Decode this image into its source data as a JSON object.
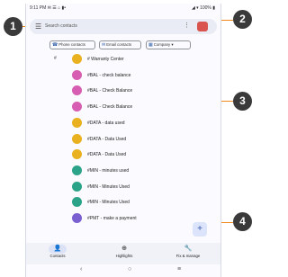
{
  "status_bar": {
    "time": "9:11 PM ✉ ☰ ⌂ ▮•",
    "right": "◢ ▾ 100% ▮"
  },
  "search": {
    "menu_icon": "☰",
    "placeholder": "Search contacts",
    "overflow_icon": "⋮"
  },
  "chips": [
    {
      "icon": "☎",
      "label": "Phone contacts"
    },
    {
      "icon": "✉",
      "label": "Email contacts"
    },
    {
      "icon": "▦",
      "label": "Company ▾"
    }
  ],
  "section_header": "#",
  "contacts": [
    {
      "label": "# Warranty Center"
    },
    {
      "label": "#BAL - check balance"
    },
    {
      "label": "#BAL - Check Balance"
    },
    {
      "label": "#BAL - Check Balance"
    },
    {
      "label": "#DATA - data used"
    },
    {
      "label": "#DATA - Data Used"
    },
    {
      "label": "#DATA - Data Used"
    },
    {
      "label": "#MIN - minutes used"
    },
    {
      "label": "#MIN - Minutes Used"
    },
    {
      "label": "#MIN - Minutes Used"
    },
    {
      "label": "#PMT - make a payment"
    }
  ],
  "avatar_colors": [
    "#e9b11f",
    "#d65db1",
    "#d65db1",
    "#d65db1",
    "#e9b11f",
    "#e9b11f",
    "#e9b11f",
    "#2aa388",
    "#2aa388",
    "#2aa388",
    "#7a5fd0"
  ],
  "fab": {
    "label": "+"
  },
  "bottom_nav": [
    {
      "icon": "👤",
      "label": "Contacts"
    },
    {
      "icon": "⊕",
      "label": "Highlights"
    },
    {
      "icon": "🔧",
      "label": "Fix & manage"
    }
  ],
  "system_nav": {
    "back": "‹",
    "home": "○",
    "recents": "≡"
  },
  "callouts": [
    "1",
    "2",
    "3",
    "4"
  ]
}
